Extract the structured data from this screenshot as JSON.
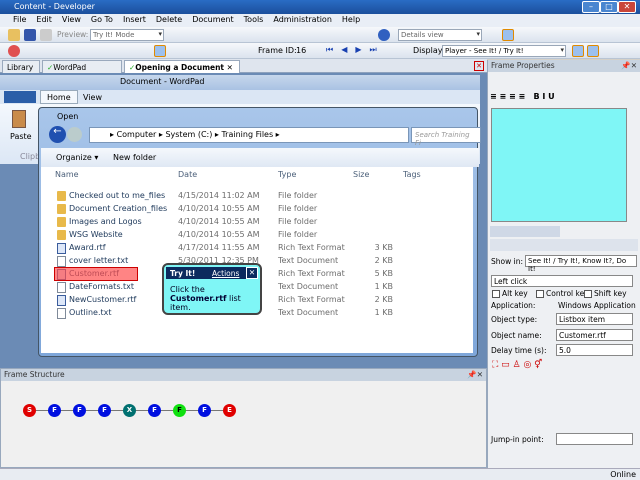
{
  "window": {
    "title": "Content - Developer"
  },
  "menu": [
    "File",
    "Edit",
    "View",
    "Go To",
    "Insert",
    "Delete",
    "Document",
    "Tools",
    "Administration",
    "Help"
  ],
  "toolbar": {
    "preview_label": "Preview:",
    "preview_mode": "Try It! Mode",
    "view_select": "Details view",
    "frame_id_label": "Frame ID:",
    "frame_id": "16",
    "display_label": "Display:",
    "display_value": "Player - See It! / Try It!"
  },
  "tabs": [
    {
      "label": "Library"
    },
    {
      "label": "WordPad Training"
    },
    {
      "label": "Opening a Document"
    }
  ],
  "wordpad": {
    "title": "Document - WordPad",
    "ribbon_tabs": [
      "Home",
      "View"
    ],
    "paste": "Paste",
    "clipboard": "Clipbo"
  },
  "open_dialog": {
    "title": "Open",
    "path": [
      "Computer",
      "System (C:)",
      "Training Files"
    ],
    "search_placeholder": "Search Training Fi",
    "organize": "Organize",
    "new_folder": "New folder",
    "columns": [
      "Name",
      "Date",
      "Type",
      "Size",
      "Tags"
    ],
    "files": [
      {
        "name": "Checked out to me_files",
        "date": "4/15/2014 11:02 AM",
        "type": "File folder",
        "size": "",
        "kind": "folder"
      },
      {
        "name": "Document Creation_files",
        "date": "4/10/2014 10:55 AM",
        "type": "File folder",
        "size": "",
        "kind": "folder"
      },
      {
        "name": "Images and Logos",
        "date": "4/10/2014 10:55 AM",
        "type": "File folder",
        "size": "",
        "kind": "folder"
      },
      {
        "name": "WSG Website",
        "date": "4/10/2014 10:55 AM",
        "type": "File folder",
        "size": "",
        "kind": "folder"
      },
      {
        "name": "Award.rtf",
        "date": "4/17/2014 11:55 AM",
        "type": "Rich Text Format",
        "size": "3 KB",
        "kind": "rtf"
      },
      {
        "name": "cover letter.txt",
        "date": "5/30/2011 12:35 PM",
        "type": "Text Document",
        "size": "2 KB",
        "kind": "txt"
      },
      {
        "name": "Customer.rtf",
        "date": "",
        "type": "Rich Text Format",
        "size": "5 KB",
        "kind": "rtf"
      },
      {
        "name": "DateFormats.txt",
        "date": "",
        "type": "Text Document",
        "size": "1 KB",
        "kind": "txt"
      },
      {
        "name": "NewCustomer.rtf",
        "date": "",
        "type": "Rich Text Format",
        "size": "2 KB",
        "kind": "rtf"
      },
      {
        "name": "Outline.txt",
        "date": "",
        "type": "Text Document",
        "size": "1 KB",
        "kind": "txt"
      }
    ]
  },
  "bubble": {
    "title": "Try It!",
    "actions": "Actions",
    "text_pre": "Click the ",
    "text_bold": "Customer.rtf",
    "text_post": " list item."
  },
  "frame_properties": {
    "title": "Frame Properties",
    "show_in_label": "Show in:",
    "show_in_value": "See It! / Try It!, Know It?, Do It!",
    "action": "Left click",
    "alt_key": "Alt key",
    "control_key": "Control key",
    "shift_key": "Shift key",
    "application_label": "Application:",
    "application_value": "Windows Application",
    "object_type_label": "Object type:",
    "object_type_value": "Listbox item",
    "object_name_label": "Object name:",
    "object_name_value": "Customer.rtf",
    "delay_label": "Delay time (s):",
    "delay_value": "5.0",
    "jump_in_label": "Jump-in point:",
    "jump_in_value": ""
  },
  "frame_structure": {
    "title": "Frame Structure",
    "nodes": [
      {
        "l": "S",
        "c": "#e00000"
      },
      {
        "l": "F",
        "c": "#0010e0"
      },
      {
        "l": "F",
        "c": "#0010e0"
      },
      {
        "l": "F",
        "c": "#0010e0"
      },
      {
        "l": "X",
        "c": "#007070"
      },
      {
        "l": "F",
        "c": "#0010e0"
      },
      {
        "l": "F",
        "c": "#10e010"
      },
      {
        "l": "F",
        "c": "#0010e0"
      },
      {
        "l": "E",
        "c": "#e00000"
      }
    ]
  },
  "status": {
    "online": "Online"
  }
}
